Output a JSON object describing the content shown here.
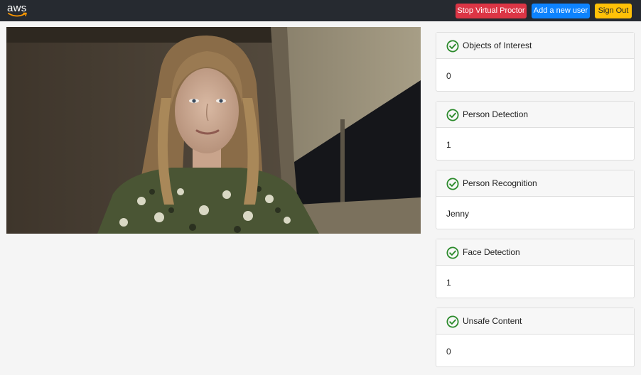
{
  "app": {
    "logo_text": "aws"
  },
  "nav": {
    "stop_label": "Stop Virtual Proctor",
    "add_user_label": "Add a new user",
    "sign_out_label": "Sign Out"
  },
  "colors": {
    "navbar": "#262a30",
    "danger": "#dc3545",
    "primary": "#0d83fd",
    "warning": "#ffc107",
    "success": "#2b8a2b"
  },
  "cards": [
    {
      "title": "Objects of Interest",
      "value": "0",
      "icon": "check-circle-icon"
    },
    {
      "title": "Person Detection",
      "value": "1",
      "icon": "check-circle-icon"
    },
    {
      "title": "Person Recognition",
      "value": "Jenny",
      "icon": "check-circle-icon"
    },
    {
      "title": "Face Detection",
      "value": "1",
      "icon": "check-circle-icon"
    },
    {
      "title": "Unsafe Content",
      "value": "0",
      "icon": "check-circle-icon"
    }
  ]
}
